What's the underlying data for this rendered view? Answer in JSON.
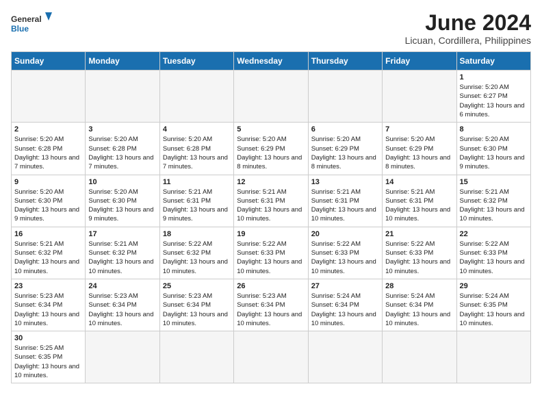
{
  "logo": {
    "line1": "General",
    "line2": "Blue"
  },
  "title": "June 2024",
  "subtitle": "Licuan, Cordillera, Philippines",
  "days_header": [
    "Sunday",
    "Monday",
    "Tuesday",
    "Wednesday",
    "Thursday",
    "Friday",
    "Saturday"
  ],
  "weeks": [
    [
      {
        "num": "",
        "info": ""
      },
      {
        "num": "",
        "info": ""
      },
      {
        "num": "",
        "info": ""
      },
      {
        "num": "",
        "info": ""
      },
      {
        "num": "",
        "info": ""
      },
      {
        "num": "",
        "info": ""
      },
      {
        "num": "1",
        "info": "Sunrise: 5:20 AM\nSunset: 6:27 PM\nDaylight: 13 hours and 6 minutes."
      }
    ],
    [
      {
        "num": "2",
        "info": "Sunrise: 5:20 AM\nSunset: 6:28 PM\nDaylight: 13 hours and 7 minutes."
      },
      {
        "num": "3",
        "info": "Sunrise: 5:20 AM\nSunset: 6:28 PM\nDaylight: 13 hours and 7 minutes."
      },
      {
        "num": "4",
        "info": "Sunrise: 5:20 AM\nSunset: 6:28 PM\nDaylight: 13 hours and 7 minutes."
      },
      {
        "num": "5",
        "info": "Sunrise: 5:20 AM\nSunset: 6:29 PM\nDaylight: 13 hours and 8 minutes."
      },
      {
        "num": "6",
        "info": "Sunrise: 5:20 AM\nSunset: 6:29 PM\nDaylight: 13 hours and 8 minutes."
      },
      {
        "num": "7",
        "info": "Sunrise: 5:20 AM\nSunset: 6:29 PM\nDaylight: 13 hours and 8 minutes."
      },
      {
        "num": "8",
        "info": "Sunrise: 5:20 AM\nSunset: 6:30 PM\nDaylight: 13 hours and 9 minutes."
      }
    ],
    [
      {
        "num": "9",
        "info": "Sunrise: 5:20 AM\nSunset: 6:30 PM\nDaylight: 13 hours and 9 minutes."
      },
      {
        "num": "10",
        "info": "Sunrise: 5:20 AM\nSunset: 6:30 PM\nDaylight: 13 hours and 9 minutes."
      },
      {
        "num": "11",
        "info": "Sunrise: 5:21 AM\nSunset: 6:31 PM\nDaylight: 13 hours and 9 minutes."
      },
      {
        "num": "12",
        "info": "Sunrise: 5:21 AM\nSunset: 6:31 PM\nDaylight: 13 hours and 10 minutes."
      },
      {
        "num": "13",
        "info": "Sunrise: 5:21 AM\nSunset: 6:31 PM\nDaylight: 13 hours and 10 minutes."
      },
      {
        "num": "14",
        "info": "Sunrise: 5:21 AM\nSunset: 6:31 PM\nDaylight: 13 hours and 10 minutes."
      },
      {
        "num": "15",
        "info": "Sunrise: 5:21 AM\nSunset: 6:32 PM\nDaylight: 13 hours and 10 minutes."
      }
    ],
    [
      {
        "num": "16",
        "info": "Sunrise: 5:21 AM\nSunset: 6:32 PM\nDaylight: 13 hours and 10 minutes."
      },
      {
        "num": "17",
        "info": "Sunrise: 5:21 AM\nSunset: 6:32 PM\nDaylight: 13 hours and 10 minutes."
      },
      {
        "num": "18",
        "info": "Sunrise: 5:22 AM\nSunset: 6:32 PM\nDaylight: 13 hours and 10 minutes."
      },
      {
        "num": "19",
        "info": "Sunrise: 5:22 AM\nSunset: 6:33 PM\nDaylight: 13 hours and 10 minutes."
      },
      {
        "num": "20",
        "info": "Sunrise: 5:22 AM\nSunset: 6:33 PM\nDaylight: 13 hours and 10 minutes."
      },
      {
        "num": "21",
        "info": "Sunrise: 5:22 AM\nSunset: 6:33 PM\nDaylight: 13 hours and 10 minutes."
      },
      {
        "num": "22",
        "info": "Sunrise: 5:22 AM\nSunset: 6:33 PM\nDaylight: 13 hours and 10 minutes."
      }
    ],
    [
      {
        "num": "23",
        "info": "Sunrise: 5:23 AM\nSunset: 6:34 PM\nDaylight: 13 hours and 10 minutes."
      },
      {
        "num": "24",
        "info": "Sunrise: 5:23 AM\nSunset: 6:34 PM\nDaylight: 13 hours and 10 minutes."
      },
      {
        "num": "25",
        "info": "Sunrise: 5:23 AM\nSunset: 6:34 PM\nDaylight: 13 hours and 10 minutes."
      },
      {
        "num": "26",
        "info": "Sunrise: 5:23 AM\nSunset: 6:34 PM\nDaylight: 13 hours and 10 minutes."
      },
      {
        "num": "27",
        "info": "Sunrise: 5:24 AM\nSunset: 6:34 PM\nDaylight: 13 hours and 10 minutes."
      },
      {
        "num": "28",
        "info": "Sunrise: 5:24 AM\nSunset: 6:34 PM\nDaylight: 13 hours and 10 minutes."
      },
      {
        "num": "29",
        "info": "Sunrise: 5:24 AM\nSunset: 6:35 PM\nDaylight: 13 hours and 10 minutes."
      }
    ],
    [
      {
        "num": "30",
        "info": "Sunrise: 5:25 AM\nSunset: 6:35 PM\nDaylight: 13 hours and 10 minutes."
      },
      {
        "num": "",
        "info": ""
      },
      {
        "num": "",
        "info": ""
      },
      {
        "num": "",
        "info": ""
      },
      {
        "num": "",
        "info": ""
      },
      {
        "num": "",
        "info": ""
      },
      {
        "num": "",
        "info": ""
      }
    ]
  ]
}
